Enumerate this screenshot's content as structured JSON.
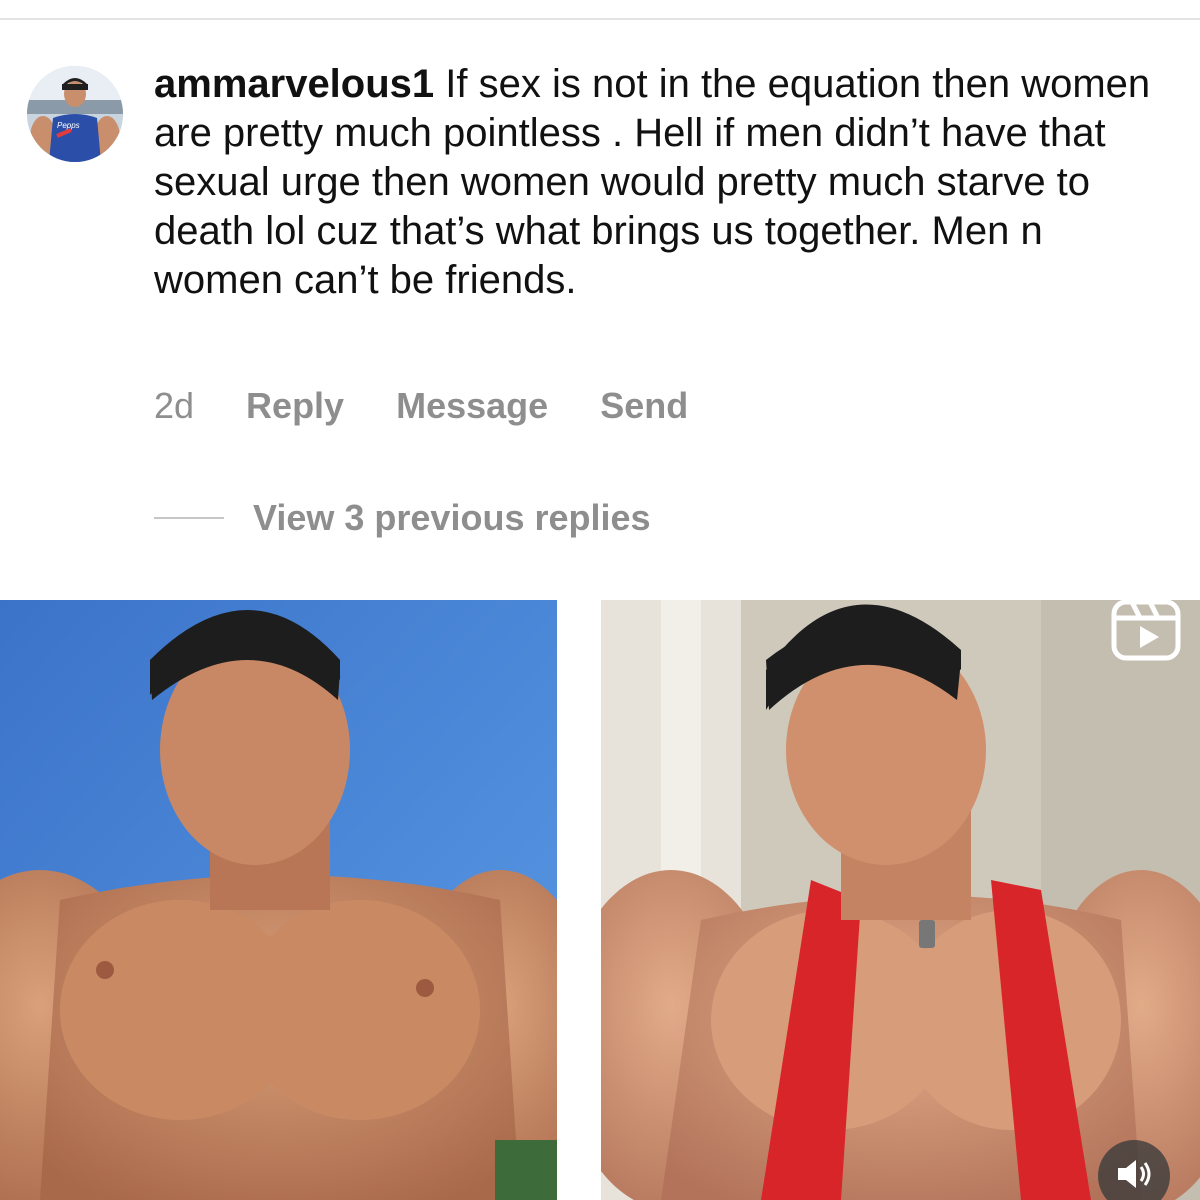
{
  "comment": {
    "username": "ammarvelous1",
    "text": "If sex is not in the equation then women are pretty much pointless . Hell if men didn’t have that sexual urge then women would pretty much starve to death lol cuz that’s what brings us together. Men n women can’t be friends.",
    "avatar_shirt_text": "Pepps",
    "time": "2d",
    "actions": {
      "reply": "Reply",
      "message": "Message",
      "send": "Send"
    },
    "view_replies": "View 3 previous replies"
  },
  "media": {
    "left_photo": "photo",
    "right_photo": "reel-video",
    "reel_icon": "reels-icon",
    "sound_icon": "speaker-icon"
  },
  "colors": {
    "text": "#111111",
    "secondary": "#8e8e8e",
    "divider": "#e4e4e4",
    "sky": "#3f7fd6",
    "tank_top": "#d8252a"
  }
}
